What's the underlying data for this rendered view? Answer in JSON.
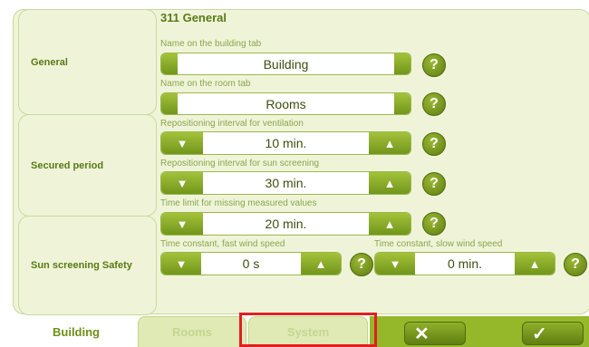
{
  "section_title": "311 General",
  "side_panels": [
    "General",
    "Secured period",
    "Sun screening Safety"
  ],
  "fields": {
    "building_name": {
      "label": "Name on the building tab",
      "value": "Building"
    },
    "room_name": {
      "label": "Name on the room tab",
      "value": "Rooms"
    },
    "ventilation_interval": {
      "label": "Repositioning interval for ventilation",
      "value": "10 min."
    },
    "sun_screening_interval": {
      "label": "Repositioning interval for sun screening",
      "value": "30 min."
    },
    "missing_values_limit": {
      "label": "Time limit for missing measured values",
      "value": "20 min."
    },
    "fast_wind_constant": {
      "label": "Time constant, fast wind speed",
      "value": "0 s"
    },
    "slow_wind_constant": {
      "label": "Time constant, slow wind speed",
      "value": "0 min."
    }
  },
  "help_glyph": "?",
  "stepper_glyphs": {
    "decrease": "▼",
    "increase": "▲"
  },
  "tabs": [
    {
      "label": "Building",
      "active": true
    },
    {
      "label": "Rooms",
      "active": false
    },
    {
      "label": "System",
      "active": false
    }
  ],
  "actions": {
    "cancel_glyph": "✕",
    "confirm_glyph": "✓"
  },
  "icons": [
    "help-icon",
    "arrow-down-icon",
    "arrow-up-icon",
    "cancel-icon",
    "checkmark-icon"
  ],
  "colors": {
    "accent": "#7a9a1e",
    "panel": "#eff4d9",
    "highlight": "#e02020"
  }
}
